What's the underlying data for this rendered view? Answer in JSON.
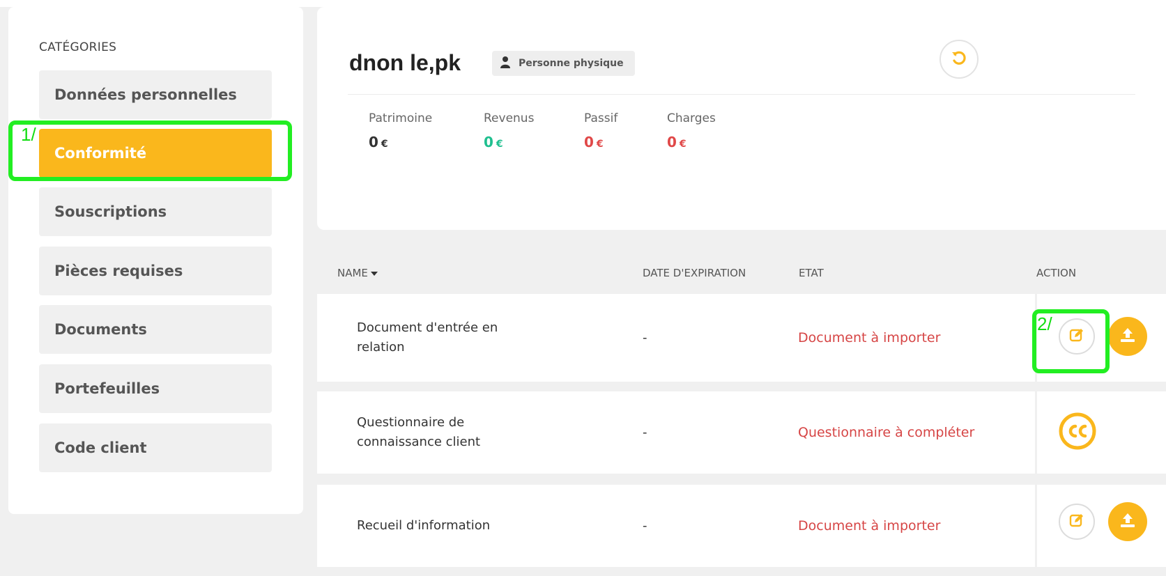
{
  "sidebar": {
    "title": "CATÉGORIES",
    "items": [
      {
        "label": "Données personnelles",
        "active": false
      },
      {
        "label": "Conformité",
        "active": true
      },
      {
        "label": "Souscriptions",
        "active": false
      },
      {
        "label": "Pièces requises",
        "active": false
      },
      {
        "label": "Documents",
        "active": false
      },
      {
        "label": "Portefeuilles",
        "active": false
      },
      {
        "label": "Code client",
        "active": false
      }
    ]
  },
  "header": {
    "client_name": "dnon le,pk",
    "type_badge": "Personne physique",
    "stats": [
      {
        "label": "Patrimoine",
        "value": "0",
        "currency": "€",
        "color": "#333333"
      },
      {
        "label": "Revenus",
        "value": "0",
        "currency": "€",
        "color": "#1fbf8f"
      },
      {
        "label": "Passif",
        "value": "0",
        "currency": "€",
        "color": "#e04848"
      },
      {
        "label": "Charges",
        "value": "0",
        "currency": "€",
        "color": "#e04848"
      }
    ]
  },
  "table": {
    "columns": {
      "name": "NAME",
      "expiry": "DATE D'EXPIRATION",
      "etat": "ETAT",
      "action": "ACTION"
    },
    "rows": [
      {
        "name": "Document d'entrée en relation",
        "expiry": "-",
        "etat": "Document à importer",
        "actions": [
          "edit-icon",
          "upload-icon"
        ]
      },
      {
        "name": "Questionnaire de connaissance client",
        "expiry": "-",
        "etat": "Questionnaire à compléter",
        "actions": [
          "cc-icon"
        ]
      },
      {
        "name": "Recueil d'information",
        "expiry": "-",
        "etat": "Document à importer",
        "actions": [
          "edit-icon",
          "upload-icon"
        ]
      }
    ]
  },
  "annotations": {
    "label_1": "1/",
    "label_2": "2/",
    "color": "#22ee22"
  },
  "colors": {
    "accent": "#fab71c",
    "danger": "#d64545",
    "success": "#1fbf8f"
  }
}
